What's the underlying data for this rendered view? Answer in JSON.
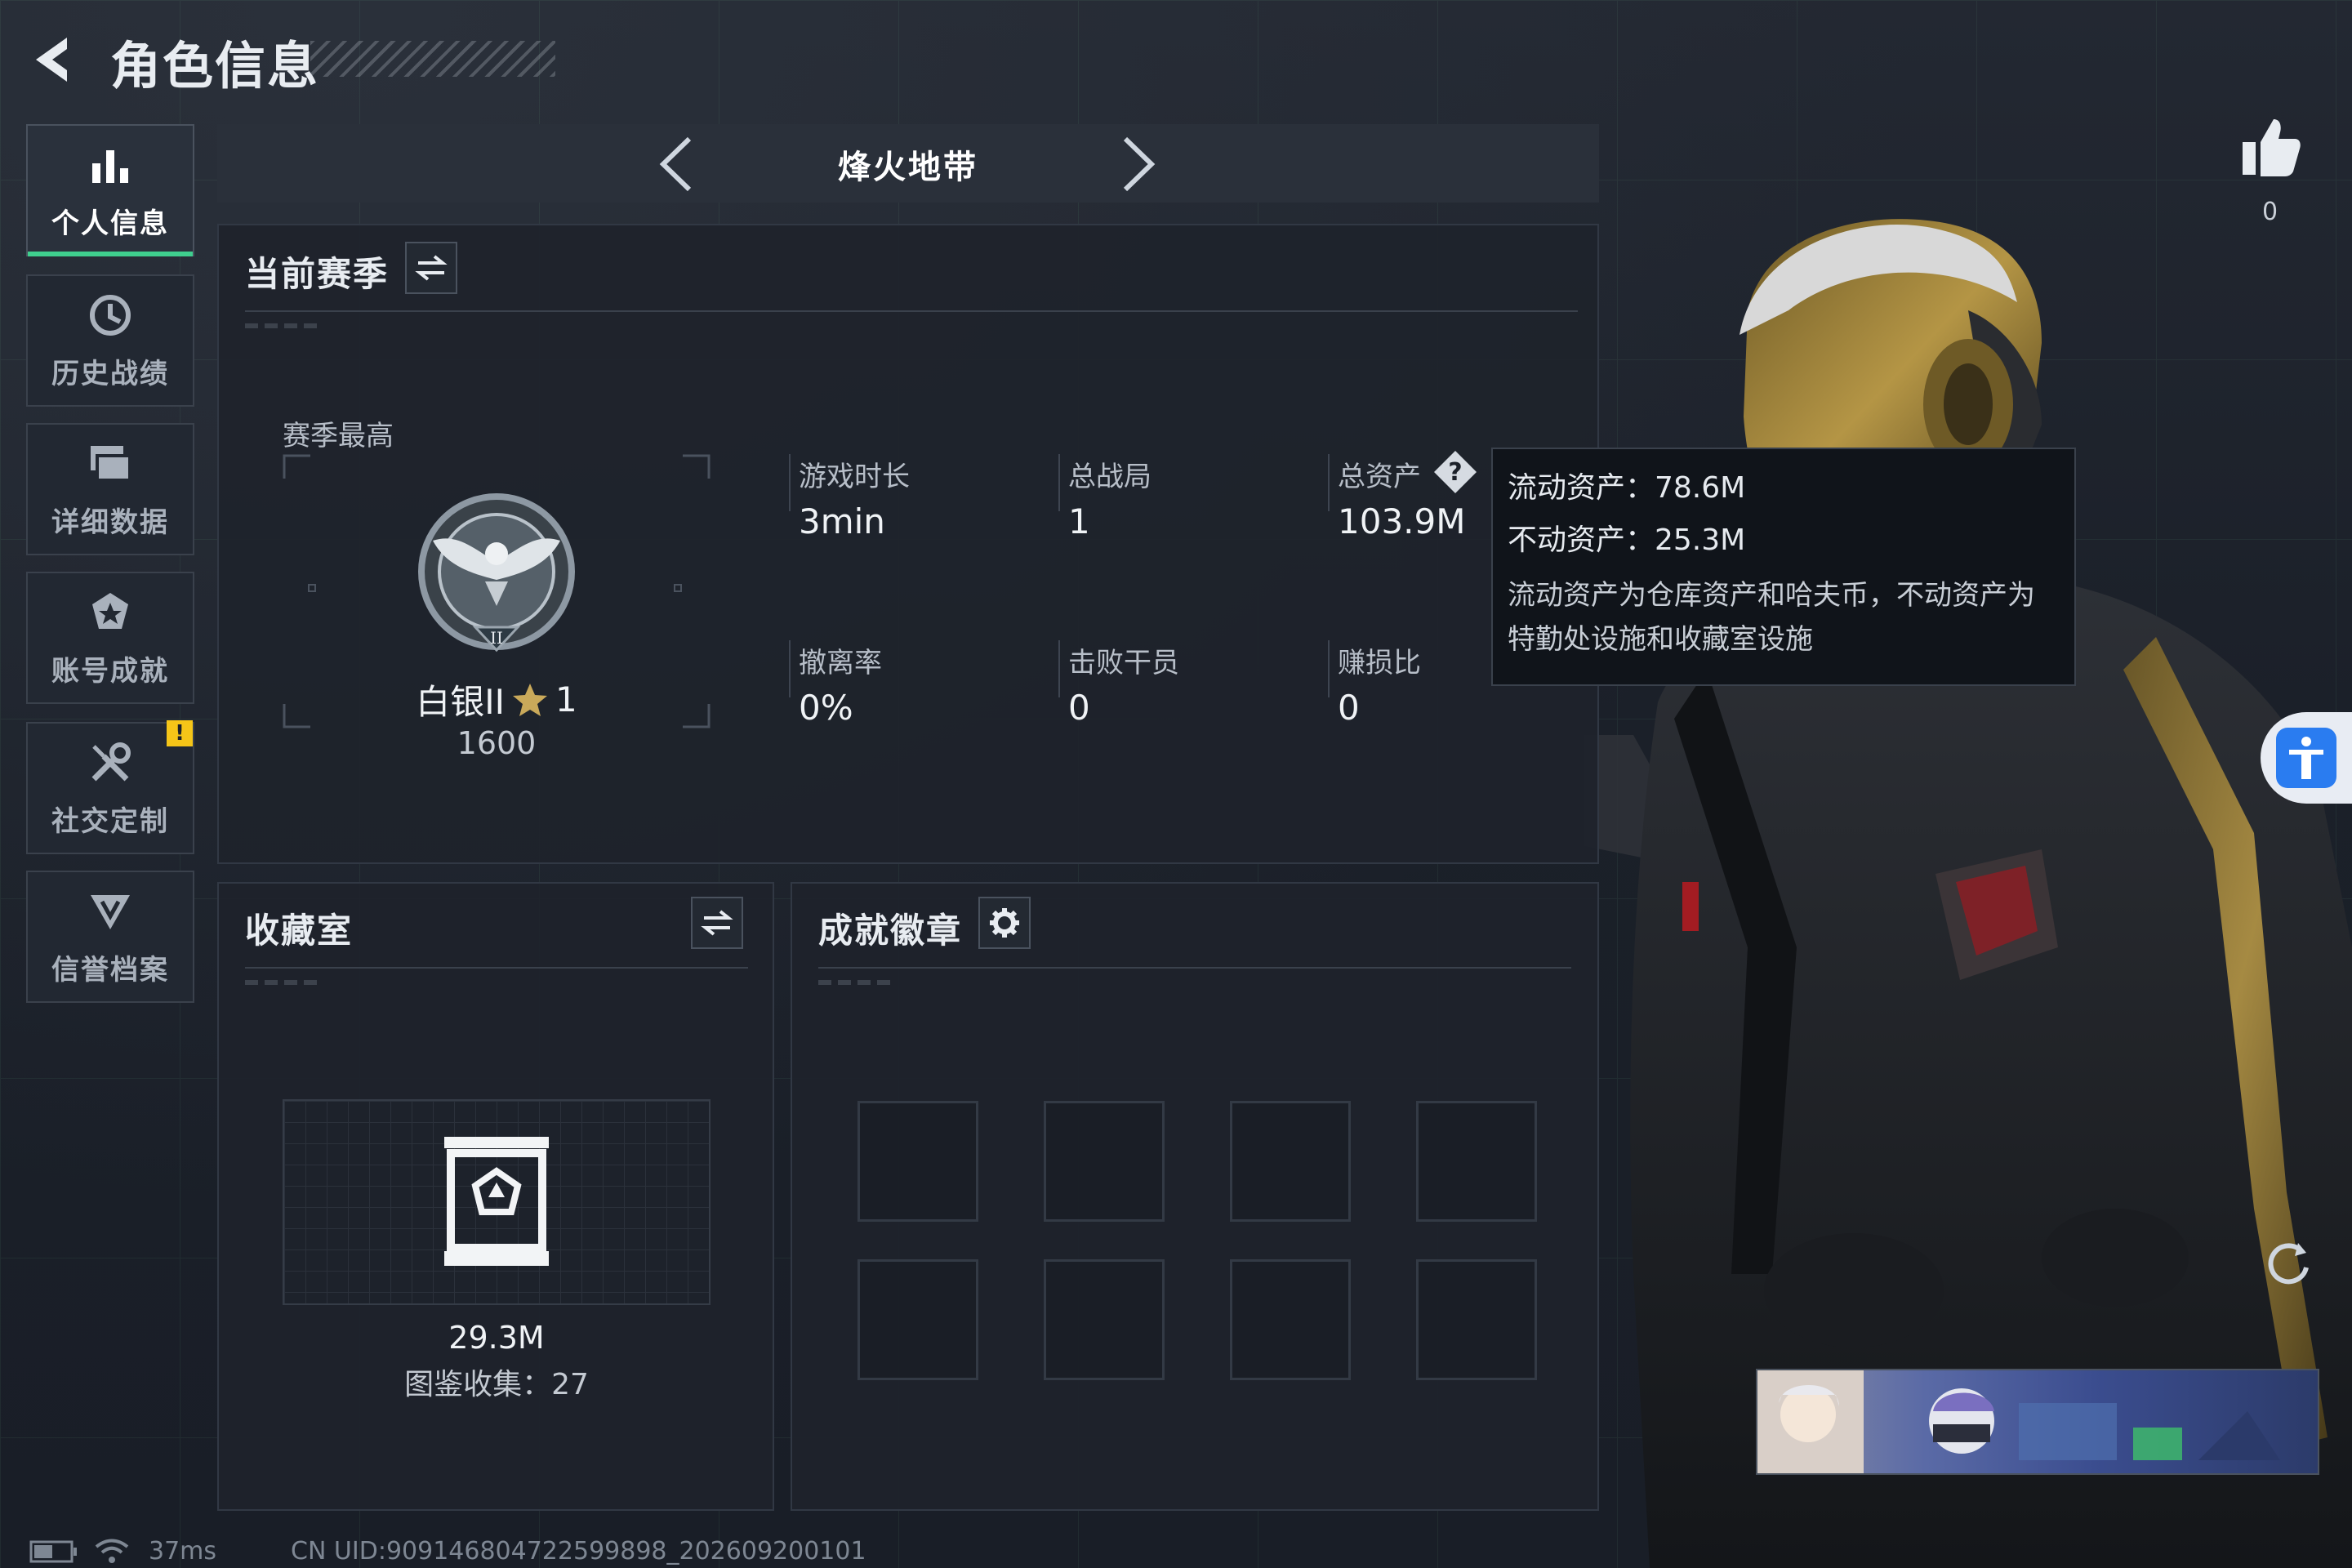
{
  "header": {
    "title": "角色信息"
  },
  "sidebar": {
    "items": [
      {
        "label": "个人信息",
        "icon": "bar-chart-icon",
        "active": true
      },
      {
        "label": "历史战绩",
        "icon": "history-icon",
        "active": false
      },
      {
        "label": "详细数据",
        "icon": "data-icon",
        "active": false
      },
      {
        "label": "账号成就",
        "icon": "achievement-icon",
        "active": false
      },
      {
        "label": "社交定制",
        "icon": "tools-icon",
        "active": false,
        "badge": "!"
      },
      {
        "label": "信誉档案",
        "icon": "credit-icon",
        "active": false
      }
    ]
  },
  "mode_selector": {
    "label": "烽火地带"
  },
  "season": {
    "title": "当前赛季",
    "best_label": "赛季最高",
    "rank_name": "白银II",
    "rank_stars": "1",
    "rank_score": "1600",
    "rank_emblem_numeral": "II",
    "stats": [
      {
        "label": "游戏时长",
        "value": "3min"
      },
      {
        "label": "总战局",
        "value": "1"
      },
      {
        "label": "总资产",
        "value": "103.9M",
        "has_help": true
      },
      {
        "label": "撤离率",
        "value": "0%"
      },
      {
        "label": "击败干员",
        "value": "0"
      },
      {
        "label": "赚损比",
        "value": "0"
      }
    ]
  },
  "tooltip": {
    "liquid": "流动资产：78.6M",
    "fixed": "不动资产：25.3M",
    "note": "流动资产为仓库资产和哈夫币，不动资产为特勤处设施和收藏室设施"
  },
  "collection": {
    "title": "收藏室",
    "value": "29.3M",
    "catalog": "图鉴收集：27"
  },
  "badges": {
    "title": "成就徽章",
    "slots": 8
  },
  "likes": {
    "count": "0"
  },
  "status_bar": {
    "ping": "37ms",
    "uid": "CN UID:909146804722599898_202609200101"
  },
  "colors": {
    "accent_green": "#3fcf8e",
    "warning": "#f5c518",
    "accessibility_blue": "#2a7cf0"
  }
}
